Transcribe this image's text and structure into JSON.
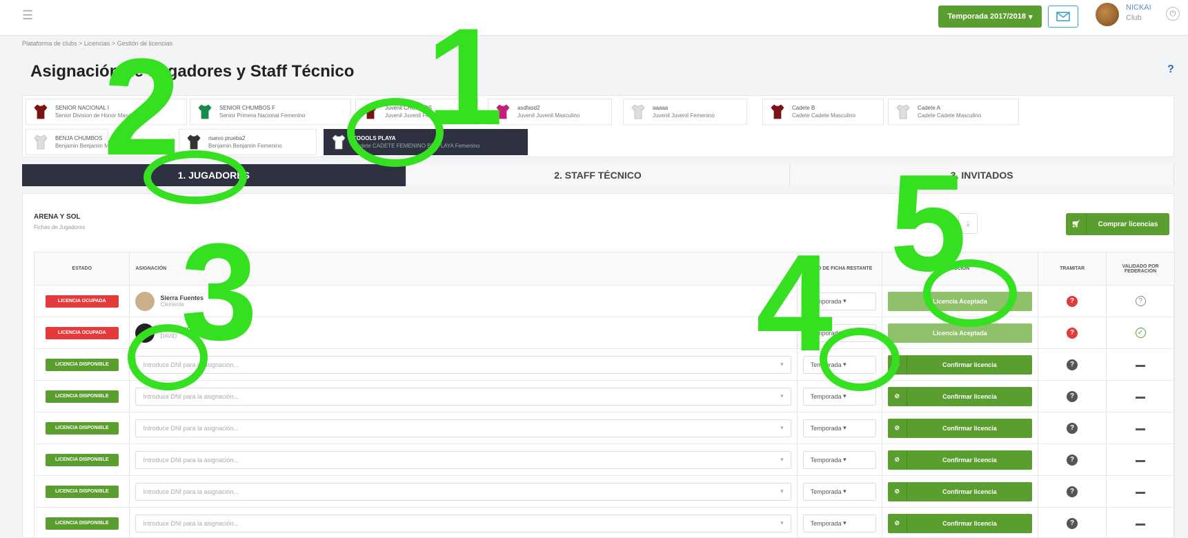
{
  "topbar": {
    "menu_icon": "hamburger-icon",
    "season_button": "Temporada 2017/2018",
    "mail_icon": "mail-icon",
    "user_name": "NICKAI",
    "user_club": "Club",
    "logout_icon": "power-icon"
  },
  "breadcrumb": "Plataforma de clubs  >  Licencias  >  Gestión de licencias",
  "page_title": "Asignación de Jugadores y Staff Técnico",
  "help": "?",
  "teams": [
    {
      "name": "SENIOR NACIONAL I",
      "sub": "Senior Division de Honor Masculino",
      "color": "#7a1414"
    },
    {
      "name": "SENIOR CHUMBOS F",
      "sub": "Senior Primera Nacional Femenino",
      "color": "#1a8a4a"
    },
    {
      "name": "Juvenil CHUMBOS",
      "sub": "Juvenil Juvenil Femenino",
      "color": "#7a1414"
    },
    {
      "name": "asdfasd2",
      "sub": "Juvenil Juvenil Masculino",
      "color": "#c21e7a"
    },
    {
      "name": "aaaaa",
      "sub": "Juvenil Juvenil Femenino",
      "color": "#dddddd"
    },
    {
      "name": "Cadete B",
      "sub": "Cadete Cadete Masculino",
      "color": "#7a1414"
    },
    {
      "name": "Cadete A",
      "sub": "Cadete Cadete Masculino",
      "color": "#dddddd"
    },
    {
      "name": "BENJA CHUMBOS",
      "sub": "Benjamin Benjamin Masculino",
      "color": "#dddddd"
    },
    {
      "name": "nuevo prueba2",
      "sub": "Benjamin Benjamin Femenino",
      "color": "#333333"
    },
    {
      "name": "TOOOLS PLAYA",
      "sub": "Cadete CADETE FEMENINO BM PLAYA Femenino",
      "color": "#ffffff"
    }
  ],
  "tabs": [
    "1. JUGADORES",
    "2. STAFF TÉCNICO",
    "3. INVITADOS"
  ],
  "section": {
    "title": "ARENA Y SOL",
    "subtitle": "Fichas de Jugadores"
  },
  "buy_button": "Comprar licencias",
  "columns": [
    "ESTADO",
    "ASIGNACIÓN",
    "TIEMPO DE FICHA RESTANTE",
    "ACCIÓN",
    "TRAMITAR",
    "VALIDADO POR FEDERACIÓN"
  ],
  "rows": [
    {
      "status": "LICENCIA OCUPADA",
      "name": "Sierra Fuentes",
      "sub": "Clemente",
      "season": "Temporada",
      "action": "Licencia Aceptada",
      "valid": "?"
    },
    {
      "status": "LICENCIA OCUPADA",
      "name": "BERMEJO LÁZARO",
      "sub": "DAVID",
      "season": "Temporada",
      "action": "Licencia Aceptada",
      "valid": "✓"
    },
    {
      "status": "LICENCIA DISPONIBLE",
      "placeholder": "Introduce DNI para la asignación...",
      "season": "Temporada",
      "action": "Confirmar licencia"
    },
    {
      "status": "LICENCIA DISPONIBLE",
      "placeholder": "Introduce DNI para la asignación...",
      "season": "Temporada",
      "action": "Confirmar licencia"
    },
    {
      "status": "LICENCIA DISPONIBLE",
      "placeholder": "Introduce DNI para la asignación...",
      "season": "Temporada",
      "action": "Confirmar licencia"
    },
    {
      "status": "LICENCIA DISPONIBLE",
      "placeholder": "Introduce DNI para la asignación...",
      "season": "Temporada",
      "action": "Confirmar licencia"
    },
    {
      "status": "LICENCIA DISPONIBLE",
      "placeholder": "Introduce DNI para la asignación...",
      "season": "Temporada",
      "action": "Confirmar licencia"
    },
    {
      "status": "LICENCIA DISPONIBLE",
      "placeholder": "Introduce DNI para la asignación...",
      "season": "Temporada",
      "action": "Confirmar licencia"
    }
  ],
  "annotations": [
    "1",
    "2",
    "3",
    "4",
    "5"
  ],
  "colors": {
    "accent_green": "#5a9e2f",
    "annotation_green": "#35e020",
    "occupied_red": "#e33b3b",
    "dark_navy": "#2d3140"
  }
}
